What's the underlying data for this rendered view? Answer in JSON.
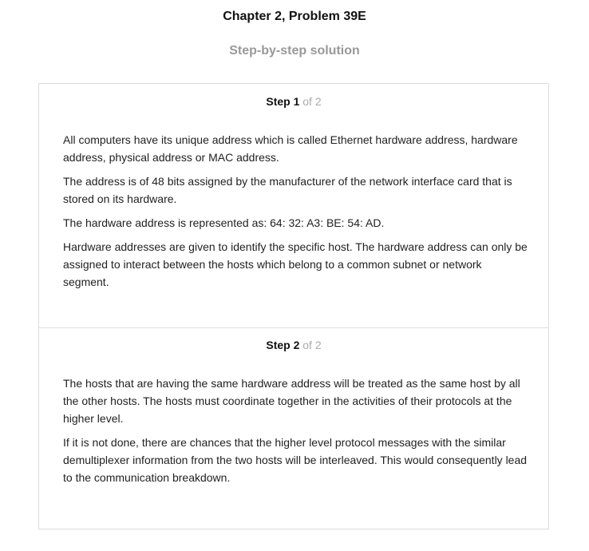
{
  "header": {
    "title": "Chapter 2, Problem 39E",
    "subtitle": "Step-by-step solution"
  },
  "steps": [
    {
      "label": "Step 1",
      "of": "of 2",
      "paragraphs": [
        "All computers have its unique address which is called Ethernet hardware address, hardware address, physical address or MAC address.",
        "The address is of 48 bits assigned by the manufacturer of the network interface card that is stored on its hardware.",
        "The hardware address is represented as: 64: 32: A3: BE: 54: AD.",
        "Hardware addresses are given to identify the specific host. The hardware address can only be assigned to interact between the hosts which belong to a common subnet or network segment."
      ]
    },
    {
      "label": "Step 2",
      "of": "of 2",
      "paragraphs": [
        "The hosts that are having the same hardware address will be treated as the same host by all the other hosts. The hosts must coordinate together in the activities of their protocols at the higher level.",
        "If it is not done, there are chances that the higher level protocol messages with the similar demultiplexer information from the two hosts will be interleaved. This would consequently lead to the communication breakdown."
      ]
    }
  ]
}
